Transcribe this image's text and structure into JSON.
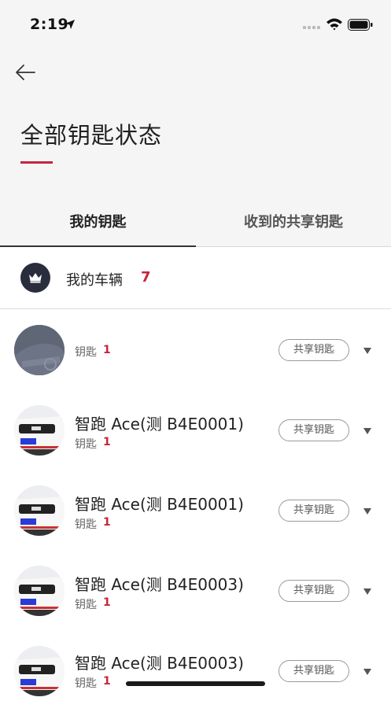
{
  "status_bar": {
    "time": "2:19"
  },
  "header": {
    "title": "全部钥匙状态"
  },
  "tabs": [
    {
      "label": "我的钥匙",
      "active": true
    },
    {
      "label": "收到的共享钥匙",
      "active": false
    }
  ],
  "vehicles_summary": {
    "label": "我的车辆",
    "count": "7"
  },
  "colors": {
    "accent": "#c8243d",
    "badge_bg": "#2a2d3b"
  },
  "cars": [
    {
      "name": "",
      "key_label": "钥匙",
      "key_count": "1",
      "share_label": "共享钥匙"
    },
    {
      "name": "智跑 Ace(测 B4E0001)",
      "key_label": "钥匙",
      "key_count": "1",
      "share_label": "共享钥匙"
    },
    {
      "name": "智跑 Ace(测 B4E0001)",
      "key_label": "钥匙",
      "key_count": "1",
      "share_label": "共享钥匙"
    },
    {
      "name": "智跑 Ace(测 B4E0003)",
      "key_label": "钥匙",
      "key_count": "1",
      "share_label": "共享钥匙"
    },
    {
      "name": "智跑 Ace(测 B4E0003)",
      "key_label": "钥匙",
      "key_count": "1",
      "share_label": "共享钥匙"
    }
  ]
}
